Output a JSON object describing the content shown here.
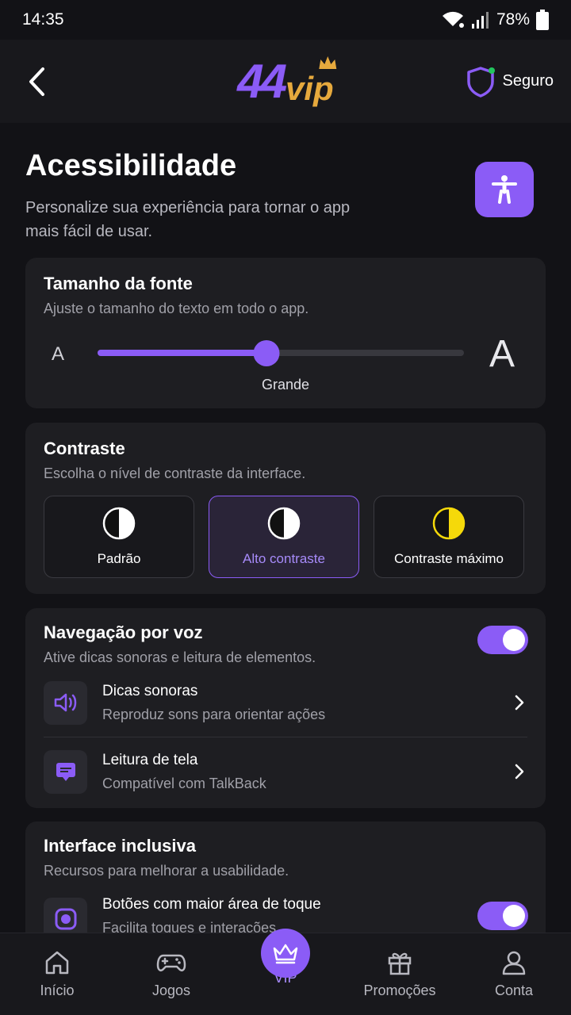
{
  "status_bar": {
    "time": "14:35",
    "battery": "78%",
    "icons": [
      "wifi-icon",
      "signal-icon",
      "battery-icon"
    ]
  },
  "header": {
    "logo_number": "44",
    "logo_text": "vip",
    "secure_label": "Seguro"
  },
  "page": {
    "title": "Acessibilidade",
    "subtitle": "Personalize sua experiência para tornar o app mais fácil de usar."
  },
  "font_size": {
    "title": "Tamanho da fonte",
    "subtitle": "Ajuste o tamanho do texto em todo o app.",
    "small_glyph": "A",
    "large_glyph": "A",
    "level_label": "Grande",
    "level_fraction": 0.46
  },
  "contrast": {
    "title": "Contraste",
    "subtitle": "Escolha o nível de contraste da interface.",
    "options": [
      {
        "label": "Padrão",
        "selected": false
      },
      {
        "label": "Alto contraste",
        "selected": true
      },
      {
        "label": "Contraste máximo",
        "selected": false
      }
    ]
  },
  "voice_nav": {
    "title": "Navegação por voz",
    "subtitle": "Ative dicas sonoras e leitura de elementos.",
    "enabled": true,
    "items": [
      {
        "title": "Dicas sonoras",
        "subtitle": "Reproduz sons para orientar ações",
        "icon": "speaker-icon"
      },
      {
        "title": "Leitura de tela",
        "subtitle": "Compatível com TalkBack",
        "icon": "screen-reader-icon"
      }
    ]
  },
  "interface": {
    "title": "Interface inclusiva",
    "subtitle": "Recursos para melhorar a usabilidade.",
    "items": [
      {
        "title": "Botões com maior área de toque",
        "subtitle": "Facilita toques e interações",
        "enabled": true
      }
    ]
  },
  "bottom_nav": {
    "items": [
      {
        "label": "Início",
        "icon": "home-icon"
      },
      {
        "label": "Jogos",
        "icon": "gamepad-icon"
      },
      {
        "label": "VIP",
        "icon": "crown-icon",
        "active": true
      },
      {
        "label": "Promoções",
        "icon": "gift-icon"
      },
      {
        "label": "Conta",
        "icon": "user-icon"
      }
    ]
  },
  "colors": {
    "accent": "#8b5cf6",
    "gold": "#e6a93d",
    "background": "#121216",
    "card": "#1e1e22"
  }
}
